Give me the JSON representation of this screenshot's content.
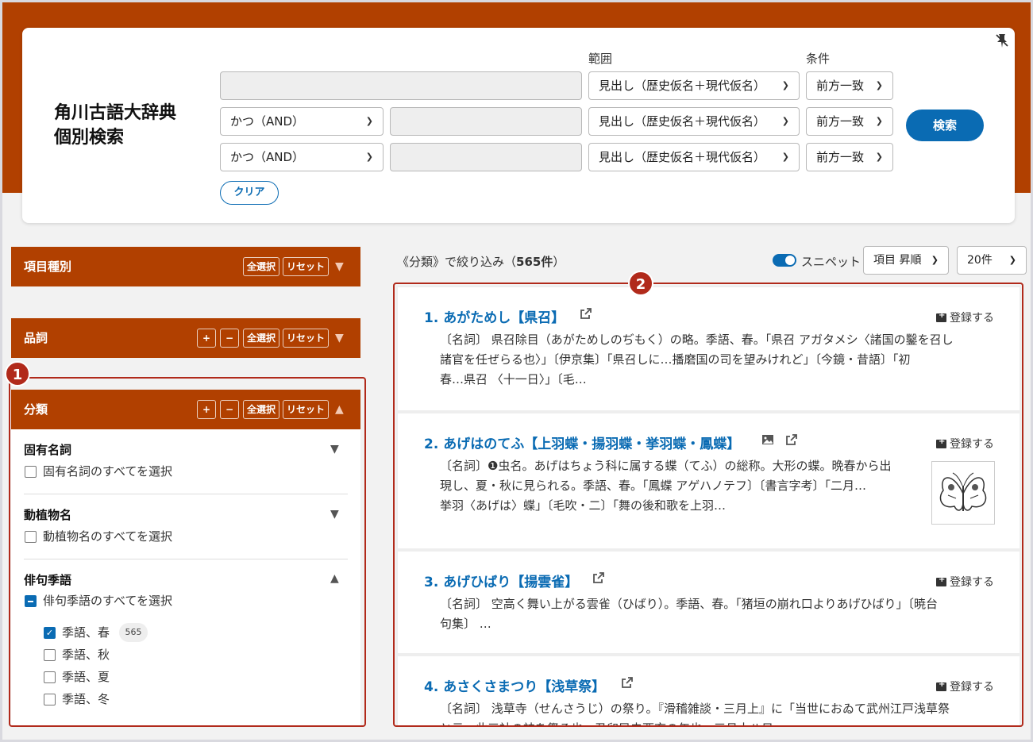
{
  "search": {
    "dict_title_line1": "角川古語大辞典",
    "dict_title_line2": "個別検索",
    "label_range": "範囲",
    "label_condition": "条件",
    "operators": [
      "かつ（AND）",
      "かつ（AND）"
    ],
    "range_values": [
      "見出し（歴史仮名＋現代仮名）",
      "見出し（歴史仮名＋現代仮名）",
      "見出し（歴史仮名＋現代仮名）"
    ],
    "condition_values": [
      "前方一致",
      "前方一致",
      "前方一致"
    ],
    "search_button": "検索",
    "clear_button": "クリア"
  },
  "facets": {
    "item_type": {
      "title": "項目種別",
      "select_all": "全選択",
      "reset": "リセット"
    },
    "pos": {
      "title": "品詞",
      "plus": "+",
      "minus": "−",
      "select_all": "全選択",
      "reset": "リセット"
    },
    "bunrui": {
      "title": "分類",
      "plus": "+",
      "minus": "−",
      "select_all": "全選択",
      "reset": "リセット",
      "groups": [
        {
          "title": "固有名詞",
          "all_label": "固有名詞のすべてを選択"
        },
        {
          "title": "動植物名",
          "all_label": "動植物名のすべてを選択"
        },
        {
          "title": "俳句季語",
          "all_label": "俳句季語のすべてを選択"
        }
      ],
      "season_items": [
        {
          "label": "季語、春",
          "checked": true,
          "count": "565"
        },
        {
          "label": "季語、秋",
          "checked": false
        },
        {
          "label": "季語、夏",
          "checked": false
        },
        {
          "label": "季語、冬",
          "checked": false
        }
      ]
    }
  },
  "markers": {
    "one": "1",
    "two": "2"
  },
  "toolbar": {
    "filter_prefix": "《分類》で絞り込み（",
    "filter_count": "565件",
    "filter_suffix": "）",
    "snippet_label": "スニペット",
    "sort_label": "項目 昇順",
    "per_page": "20件"
  },
  "results": [
    {
      "title": "1. あがためし【県召】",
      "register": "登録する",
      "snippet": [
        "〔名詞〕 県召除目（あがためしのぢもく）の略。季語、春。「県召 アガタメシ〈諸国の鑿を召し",
        "諸官を任ぜらる也〉」〔伊京集〕「県召しに…播磨国の司を望みけれど」〔今鏡・昔語〕「初",
        "春…県召 〈十一日〉」〔毛…"
      ]
    },
    {
      "title": "2. あげはのてふ【上羽蝶・揚羽蝶・挙羽蝶・鳳蝶】",
      "register": "登録する",
      "snippet": [
        "〔名詞〕❶虫名。あげはちょう科に属する蝶（てふ）の総称。大形の蝶。晩春から出",
        "現し、夏・秋に見られる。季語、春。「鳳蝶 アゲハノテフ〕〔書言字考〕「二月…",
        "挙羽〈あげは〉蝶」〔毛吹・二〕「舞の後和歌を上羽…"
      ]
    },
    {
      "title": "3. あげひばり【揚雲雀】",
      "register": "登録する",
      "snippet": [
        "〔名詞〕 空高く舞い上がる雲雀（ひばり）。季語、春。「猪垣の崩れ口よりあげひばり」〔暁台",
        "句集〕 …"
      ]
    },
    {
      "title": "4. あさくさまつり【浅草祭】",
      "register": "登録する",
      "snippet": [
        "〔名詞〕 浅草寺（せんさうじ）の祭り。『滑稽雑談・三月上』に「当世におゐて武州江戸浅草祭",
        "と云、此三社の神を祭る也。丑卯巳未酉亥の年也。三月十八日"
      ]
    }
  ]
}
